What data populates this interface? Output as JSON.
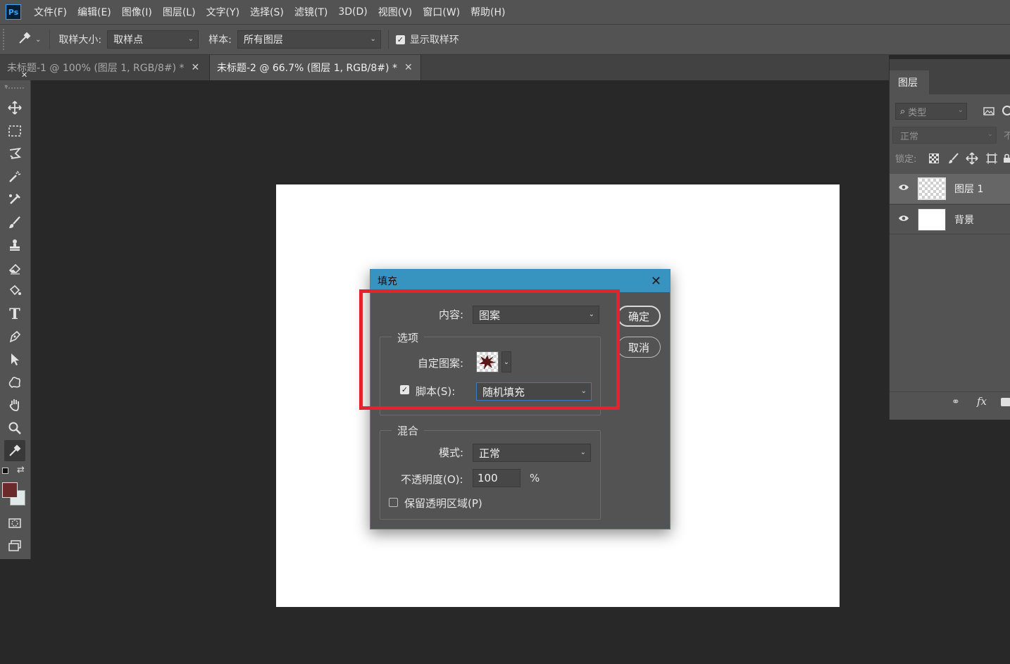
{
  "menu": {
    "logo": "Ps",
    "items": [
      "文件(F)",
      "编辑(E)",
      "图像(I)",
      "图层(L)",
      "文字(Y)",
      "选择(S)",
      "滤镜(T)",
      "3D(D)",
      "视图(V)",
      "窗口(W)",
      "帮助(H)"
    ]
  },
  "options": {
    "sample_size_label": "取样大小:",
    "sample_size_value": "取样点",
    "sample_label": "样本:",
    "sample_value": "所有图层",
    "show_ring_label": "显示取样环",
    "show_ring_checked": true
  },
  "tabs": [
    {
      "label": "未标题-1 @ 100% (图层 1, RGB/8#) *",
      "active": false
    },
    {
      "label": "未标题-2 @ 66.7% (图层 1, RGB/8#) *",
      "active": true
    }
  ],
  "tools": [
    "move-icon",
    "marquee-icon",
    "lasso-icon",
    "magic-wand-icon",
    "healing-brush-icon",
    "brush-icon",
    "stamp-icon",
    "eraser-icon",
    "paint-bucket-icon",
    "type-icon",
    "pen-icon",
    "path-selection-icon",
    "custom-shape-icon",
    "hand-icon",
    "zoom-icon",
    "eyedropper-icon"
  ],
  "colors": {
    "foreground": "#6b2a2a",
    "background": "#dfeae8",
    "dialog_title_bg": "#3794c1",
    "highlight": "#e3252b"
  },
  "layers_panel": {
    "tab": "图层",
    "filter_placeholder": "类型",
    "blend_mode": "正常",
    "opacity_cut": "不",
    "lock_label": "锁定:",
    "layers": [
      {
        "name": "图层 1",
        "thumb": "transparent",
        "selected": true
      },
      {
        "name": "背景",
        "thumb": "white",
        "selected": false
      }
    ],
    "footer_fx": "fx"
  },
  "dialog": {
    "title": "填充",
    "content_label": "内容:",
    "content_value": "图案",
    "options_group": "选项",
    "custom_pattern_label": "自定图案:",
    "script_label": "脚本(S):",
    "script_checked": true,
    "script_value": "随机填充",
    "blend_group": "混合",
    "mode_label": "模式:",
    "mode_value": "正常",
    "opacity_label": "不透明度(O):",
    "opacity_value": "100",
    "opacity_unit": "%",
    "preserve_label": "保留透明区域(P)",
    "preserve_checked": false,
    "ok_label": "确定",
    "cancel_label": "取消"
  }
}
